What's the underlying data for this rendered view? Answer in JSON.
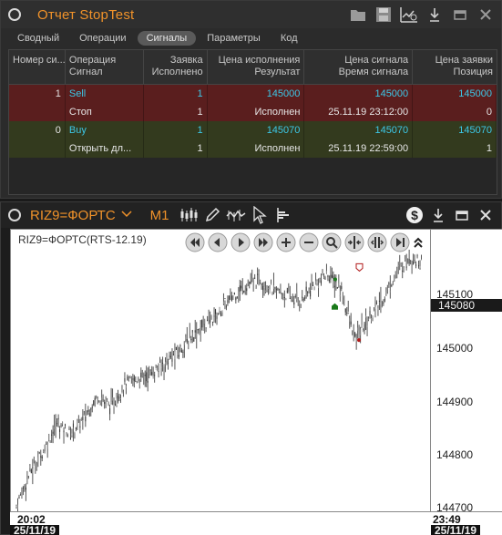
{
  "report": {
    "title": "Отчет StopTest",
    "tabs": [
      "Сводный",
      "Операции",
      "Сигналы",
      "Параметры",
      "Код"
    ],
    "active_tab": "Сигналы",
    "headers": [
      [
        "Номер си...",
        ""
      ],
      [
        "Операция",
        "Сигнал"
      ],
      [
        "Заявка",
        "Исполнено"
      ],
      [
        "Цена исполнения",
        "Результат"
      ],
      [
        "Цена сигнала",
        "Время сигнала"
      ],
      [
        "Цена заявки",
        "Позиция"
      ]
    ],
    "rows": [
      {
        "kind": "sell",
        "cells": [
          "1",
          "Sell",
          "1",
          "145000",
          "145000",
          "145000"
        ]
      },
      {
        "kind": "sell",
        "cells": [
          "",
          "Стоп",
          "1",
          "Исполнен",
          "25.11.19 23:12:00",
          "0"
        ]
      },
      {
        "kind": "buy",
        "cells": [
          "0",
          "Buy",
          "1",
          "145070",
          "145070",
          "145070"
        ]
      },
      {
        "kind": "buy",
        "cells": [
          "",
          "Открыть дл...",
          "1",
          "Исполнен",
          "25.11.19 22:59:00",
          "1"
        ]
      }
    ]
  },
  "chart": {
    "symbol": "RIZ9=ФОРТС",
    "timeframe": "M1",
    "caption": "RIZ9=ФОРТС(RTS-12.19)",
    "yticks": [
      "145100",
      "145000",
      "144900",
      "144800",
      "144700"
    ],
    "current_price": "145080",
    "time_start": "20:02",
    "time_end": "23:49",
    "date_start": "25/11/19",
    "date_end": "25/11/19",
    "icons": {
      "report_tools": [
        "folder-icon",
        "save-icon",
        "chart-settings-icon",
        "download-icon",
        "minimize-icon",
        "close-icon"
      ],
      "chart_tools": [
        "candles-icon",
        "pencil-icon",
        "indicators-icon",
        "cursor-icon",
        "depth-icon"
      ],
      "nav": [
        "first-icon",
        "prev-icon",
        "play-icon",
        "last-icon",
        "zoom-in-icon",
        "zoom-out-icon",
        "zoom-fit-icon",
        "shrink-icon",
        "expand-icon",
        "end-icon"
      ]
    },
    "colors": {
      "accent": "#f0922a",
      "buy": "#1a7a1a",
      "sell": "#b01a1a"
    }
  },
  "chart_data": {
    "type": "candlestick",
    "ylim": [
      144690,
      145200
    ],
    "price_ticks": [
      145100,
      145000,
      144900,
      144800,
      144700
    ],
    "trend_points": [
      [
        0,
        144700
      ],
      [
        10,
        144760
      ],
      [
        20,
        144800
      ],
      [
        30,
        144850
      ],
      [
        40,
        144830
      ],
      [
        50,
        144860
      ],
      [
        60,
        144900
      ],
      [
        70,
        144880
      ],
      [
        80,
        144920
      ],
      [
        90,
        144930
      ],
      [
        100,
        144940
      ],
      [
        110,
        144960
      ],
      [
        120,
        144980
      ],
      [
        130,
        145010
      ],
      [
        140,
        145030
      ],
      [
        150,
        145050
      ],
      [
        160,
        145080
      ],
      [
        170,
        145100
      ],
      [
        180,
        145110
      ],
      [
        190,
        145090
      ],
      [
        200,
        145080
      ],
      [
        210,
        145070
      ],
      [
        220,
        145100
      ],
      [
        230,
        145120
      ],
      [
        240,
        145090
      ],
      [
        250,
        145000
      ],
      [
        260,
        145040
      ],
      [
        270,
        145070
      ],
      [
        280,
        145120
      ],
      [
        290,
        145150
      ],
      [
        300,
        145140
      ]
    ],
    "signals": [
      {
        "type": "buy",
        "price": 145070
      },
      {
        "type": "sell",
        "price": 145000
      }
    ]
  }
}
